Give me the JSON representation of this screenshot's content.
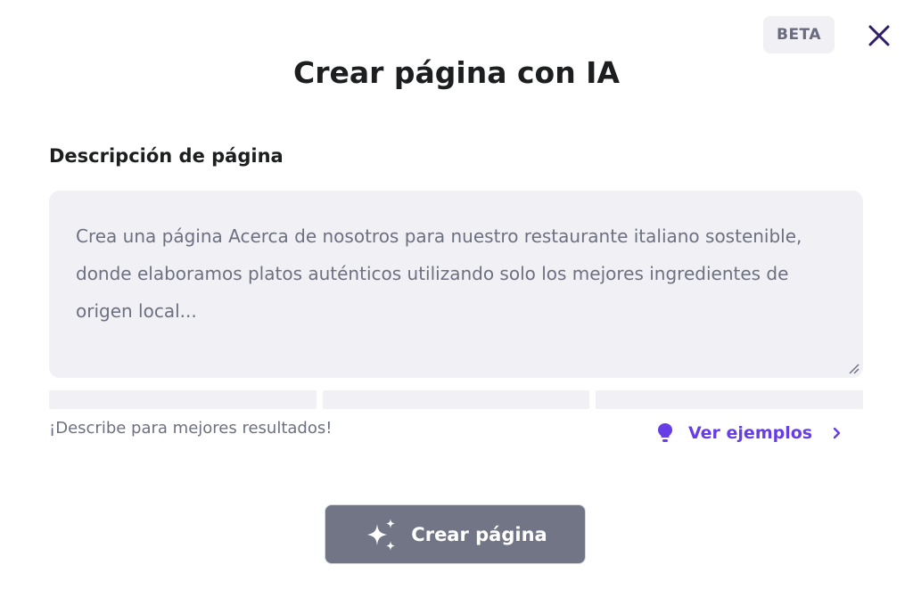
{
  "header": {
    "badge": "BETA",
    "title": "Crear página con IA",
    "close_icon": "close-icon"
  },
  "form": {
    "label": "Descripción de página",
    "placeholder": "Crea una página Acerca de nosotros para nuestro restaurante italiano sostenible, donde elaboramos platos auténticos utilizando solo los mejores ingredientes de origen local...",
    "value": "",
    "strength_segments": 3,
    "hint": "¡Describe para mejores resultados!",
    "examples_link": "Ver ejemplos",
    "examples_icon": "lightbulb-icon",
    "examples_chevron": "chevron-right-icon"
  },
  "actions": {
    "create_label": "Crear página",
    "create_icon": "sparkles-icon"
  },
  "colors": {
    "accent": "#673de6",
    "button_disabled": "#727586",
    "field_bg": "#f0f0f5",
    "text": "#1d1e20",
    "muted": "#6d7081"
  }
}
